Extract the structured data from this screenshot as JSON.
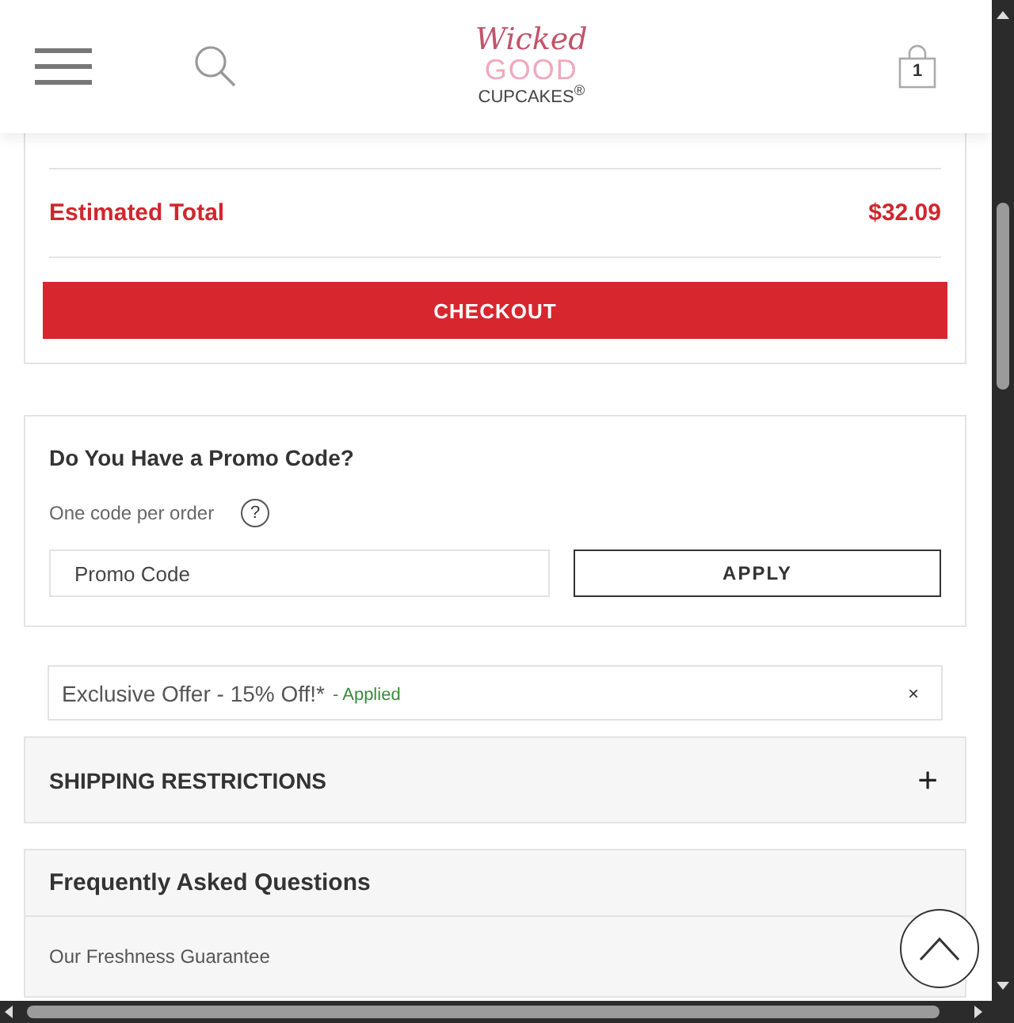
{
  "header": {
    "logo": {
      "line_1": "Wicked",
      "line_2": "GOOD",
      "line_3": "CUPCAKES$^{®}$"
    },
    "cart_count": "1"
  },
  "summary": {
    "label": "Estimated Total",
    "value": "$32.09",
    "button": "CHECKOUT"
  },
  "promo": {
    "title": "Do You Have a Promo Code?",
    "note": "One code per order",
    "help_icon": "?",
    "placeholder": "Promo Code",
    "button": "APPLY"
  },
  "applied_offer": {
    "name": "Exclusive Offer - 15% Off!*",
    "status": "- Applied",
    "remove": "×"
  },
  "sections": [
    {
      "title": "SHIPPING RESTRICTIONS",
      "toggle": "+",
      "expanded": false
    },
    {
      "title": "Frequently Asked Questions",
      "expanded": true,
      "items": [
        {
          "question": "Our Freshness Guarantee"
        }
      ]
    }
  ]
}
